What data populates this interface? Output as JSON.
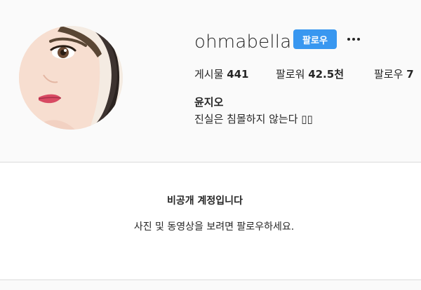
{
  "profile": {
    "username": "ohmabella",
    "follow_label": "팔로우",
    "more_icon": "more-horizontal-icon",
    "stats": {
      "posts_label": "게시물",
      "posts_count": "441",
      "followers_label": "팔로워",
      "followers_count": "42.5천",
      "following_label": "팔로우",
      "following_count": "7"
    },
    "full_name": "윤지오",
    "bio": "진실은 침몰하지 않는다 ▯▯"
  },
  "private_notice": {
    "title": "비공개 계정입니다",
    "description": "사진 및 동영상을 보려면 팔로우하세요."
  },
  "colors": {
    "accent": "#3897f0",
    "background": "#fafafa",
    "text": "#262626",
    "border": "#dbdbdb"
  }
}
